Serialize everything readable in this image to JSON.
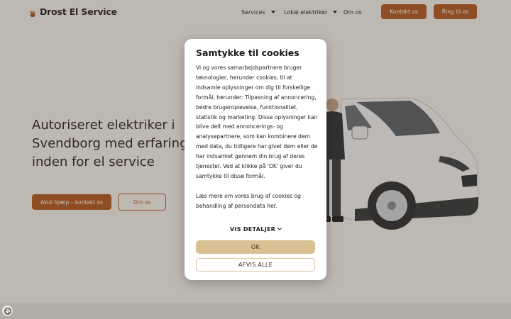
{
  "header": {
    "logo_text": "Drost El Service",
    "nav": [
      {
        "label": "Services"
      },
      {
        "label": "Lokal elektriker"
      },
      {
        "label": "Om os"
      }
    ],
    "contact_button": "Kontakt os",
    "call_button": "Ring til os"
  },
  "hero": {
    "title": "Autoriseret elektriker i Svendborg med erfaring inden for el service",
    "primary_button": "Akut hjælp – kontakt os",
    "secondary_button": "Om os"
  },
  "cookie_modal": {
    "title": "Samtykke til cookies",
    "paragraph1": "Vi og vores samarbejdspartnere bruger teknologier, herunder cookies, til at indsamle oplysninger om dig til forskellige formål, herunder: Tilpasning af annoncering, bedre brugeroplevelse, funktionalitet, statistik og marketing. Disse oplysninger kan blive delt med annoncerings- og analysepartnere, som kan kombinere dem med data, du tidligere har givet dem eller de har indsamlet gennem din brug af deres tjenester. Ved at klikke på 'OK' giver du samtykke til disse formål.",
    "paragraph2": "Læs mere om vores brug af cookies og behandling af persondata her.",
    "details_label": "VIS DETALJER",
    "ok_label": "OK",
    "decline_label": "AFVIS ALLE"
  },
  "colors": {
    "brand": "#b45a24",
    "ok_button": "#d9c092",
    "background": "#f6f3ee"
  },
  "icons": {
    "logo": "plug-icon",
    "cookie_settings": "cookie-icon"
  }
}
